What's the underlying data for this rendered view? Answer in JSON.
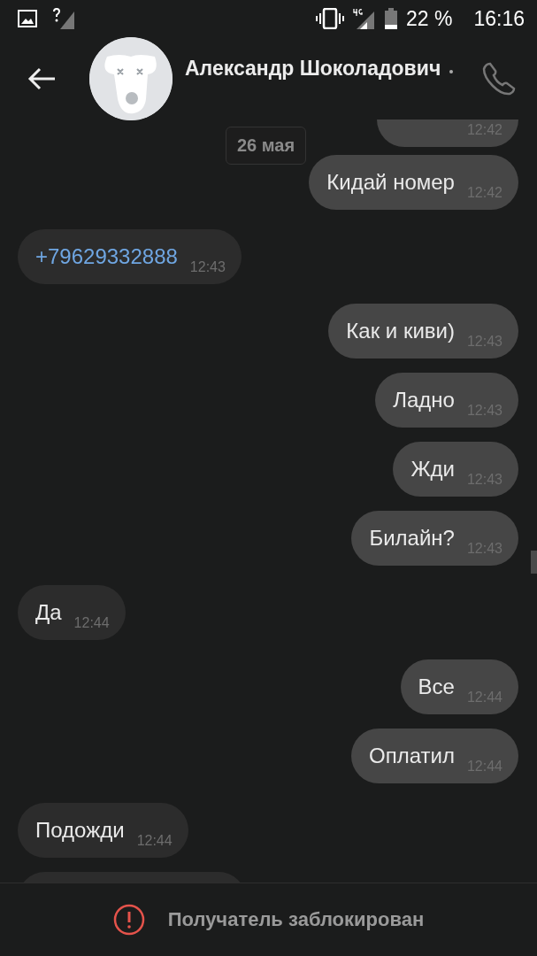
{
  "status_bar": {
    "battery": "22 %",
    "time": "16:16"
  },
  "header": {
    "name": "Александр Шоколадович"
  },
  "date_chip": "26 мая",
  "messages": [
    {
      "outgoing": true,
      "time": "12:42"
    },
    {
      "outgoing": true,
      "kind": "text",
      "text": "Кидай номер",
      "time": "12:42"
    },
    {
      "outgoing": false,
      "kind": "phone",
      "text": "+79629332888",
      "time": "12:43"
    },
    {
      "outgoing": true,
      "kind": "text",
      "text": "Как и киви)",
      "time": "12:43"
    },
    {
      "outgoing": true,
      "kind": "text",
      "text": "Ладно",
      "time": "12:43"
    },
    {
      "outgoing": true,
      "kind": "text",
      "text": "Жди",
      "time": "12:43"
    },
    {
      "outgoing": true,
      "kind": "text",
      "text": "Билайн?",
      "time": "12:43"
    },
    {
      "outgoing": false,
      "kind": "text",
      "text": "Да",
      "time": "12:44"
    },
    {
      "outgoing": true,
      "kind": "text",
      "text": "Все",
      "time": "12:44"
    },
    {
      "outgoing": true,
      "kind": "text",
      "text": "Оплатил",
      "time": "12:44"
    },
    {
      "outgoing": false,
      "kind": "text",
      "text": "Подожди",
      "time": "12:44"
    },
    {
      "outgoing": false
    }
  ],
  "footer": {
    "notice": "Получатель заблокирован"
  }
}
